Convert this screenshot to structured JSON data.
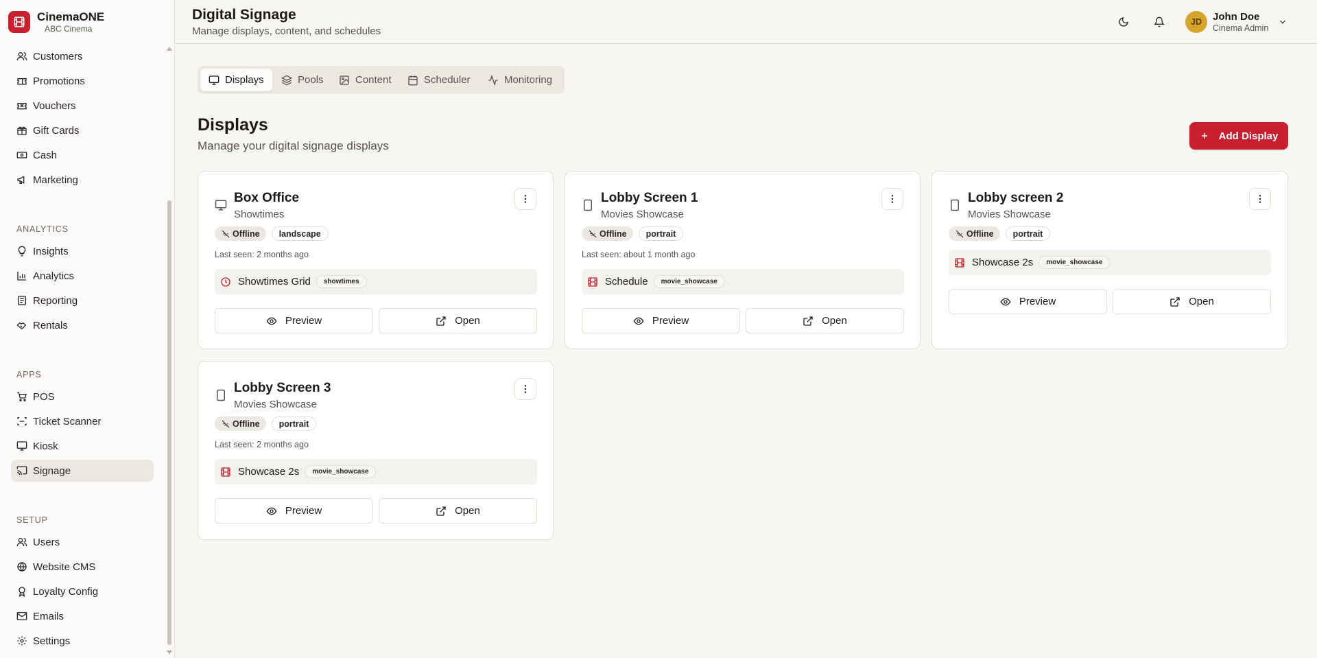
{
  "brand": {
    "name": "CinemaONE",
    "sub": "ABC Cinema"
  },
  "nav": {
    "top_items": [
      {
        "label": "Customers",
        "icon": "users-icon"
      },
      {
        "label": "Promotions",
        "icon": "ticket-icon"
      },
      {
        "label": "Vouchers",
        "icon": "voucher-icon"
      },
      {
        "label": "Gift Cards",
        "icon": "gift-icon"
      },
      {
        "label": "Cash",
        "icon": "banknote-icon"
      },
      {
        "label": "Marketing",
        "icon": "megaphone-icon"
      }
    ],
    "analytics_label": "ANALYTICS",
    "analytics_items": [
      {
        "label": "Insights",
        "icon": "lightbulb-icon"
      },
      {
        "label": "Analytics",
        "icon": "bar-chart-icon"
      },
      {
        "label": "Reporting",
        "icon": "report-icon"
      },
      {
        "label": "Rentals",
        "icon": "handshake-icon"
      }
    ],
    "apps_label": "APPS",
    "apps_items": [
      {
        "label": "POS",
        "icon": "cart-icon"
      },
      {
        "label": "Ticket Scanner",
        "icon": "scan-icon"
      },
      {
        "label": "Kiosk",
        "icon": "monitor-icon"
      },
      {
        "label": "Signage",
        "icon": "cast-icon",
        "active": true
      }
    ],
    "setup_label": "SETUP",
    "setup_items": [
      {
        "label": "Users",
        "icon": "users-icon"
      },
      {
        "label": "Website CMS",
        "icon": "globe-icon"
      },
      {
        "label": "Loyalty Config",
        "icon": "award-icon"
      },
      {
        "label": "Emails",
        "icon": "mail-icon"
      },
      {
        "label": "Settings",
        "icon": "gear-icon"
      }
    ]
  },
  "header": {
    "title": "Digital Signage",
    "subtitle": "Manage displays, content, and schedules",
    "user": {
      "initials": "JD",
      "name": "John Doe",
      "role": "Cinema Admin"
    }
  },
  "tabs": [
    {
      "label": "Displays",
      "active": true
    },
    {
      "label": "Pools"
    },
    {
      "label": "Content"
    },
    {
      "label": "Scheduler"
    },
    {
      "label": "Monitoring"
    }
  ],
  "section": {
    "title": "Displays",
    "subtitle": "Manage your digital signage displays",
    "add_label": "Add Display"
  },
  "displays": [
    {
      "name": "Box Office",
      "template": "Showtimes",
      "status": "Offline",
      "orientation": "landscape",
      "last_seen": "Last seen: 2 months ago",
      "content_name": "Showtimes Grid",
      "content_tag": "showtimes",
      "content_icon": "clock-icon"
    },
    {
      "name": "Lobby Screen 1",
      "template": "Movies Showcase",
      "status": "Offline",
      "orientation": "portrait",
      "last_seen": "Last seen: about 1 month ago",
      "content_name": "Schedule",
      "content_tag": "movie_showcase",
      "content_icon": "film-icon"
    },
    {
      "name": "Lobby screen 2",
      "template": "Movies Showcase",
      "status": "Offline",
      "orientation": "portrait",
      "last_seen": "",
      "content_name": "Showcase 2s",
      "content_tag": "movie_showcase",
      "content_icon": "film-icon"
    },
    {
      "name": "Lobby Screen 3",
      "template": "Movies Showcase",
      "status": "Offline",
      "orientation": "portrait",
      "last_seen": "Last seen: 2 months ago",
      "content_name": "Showcase 2s",
      "content_tag": "movie_showcase",
      "content_icon": "film-icon"
    }
  ],
  "card_buttons": {
    "preview": "Preview",
    "open": "Open"
  },
  "colors": {
    "brand": "#c8202f",
    "avatar": "#d6a52c",
    "background": "#f7f6f3"
  }
}
